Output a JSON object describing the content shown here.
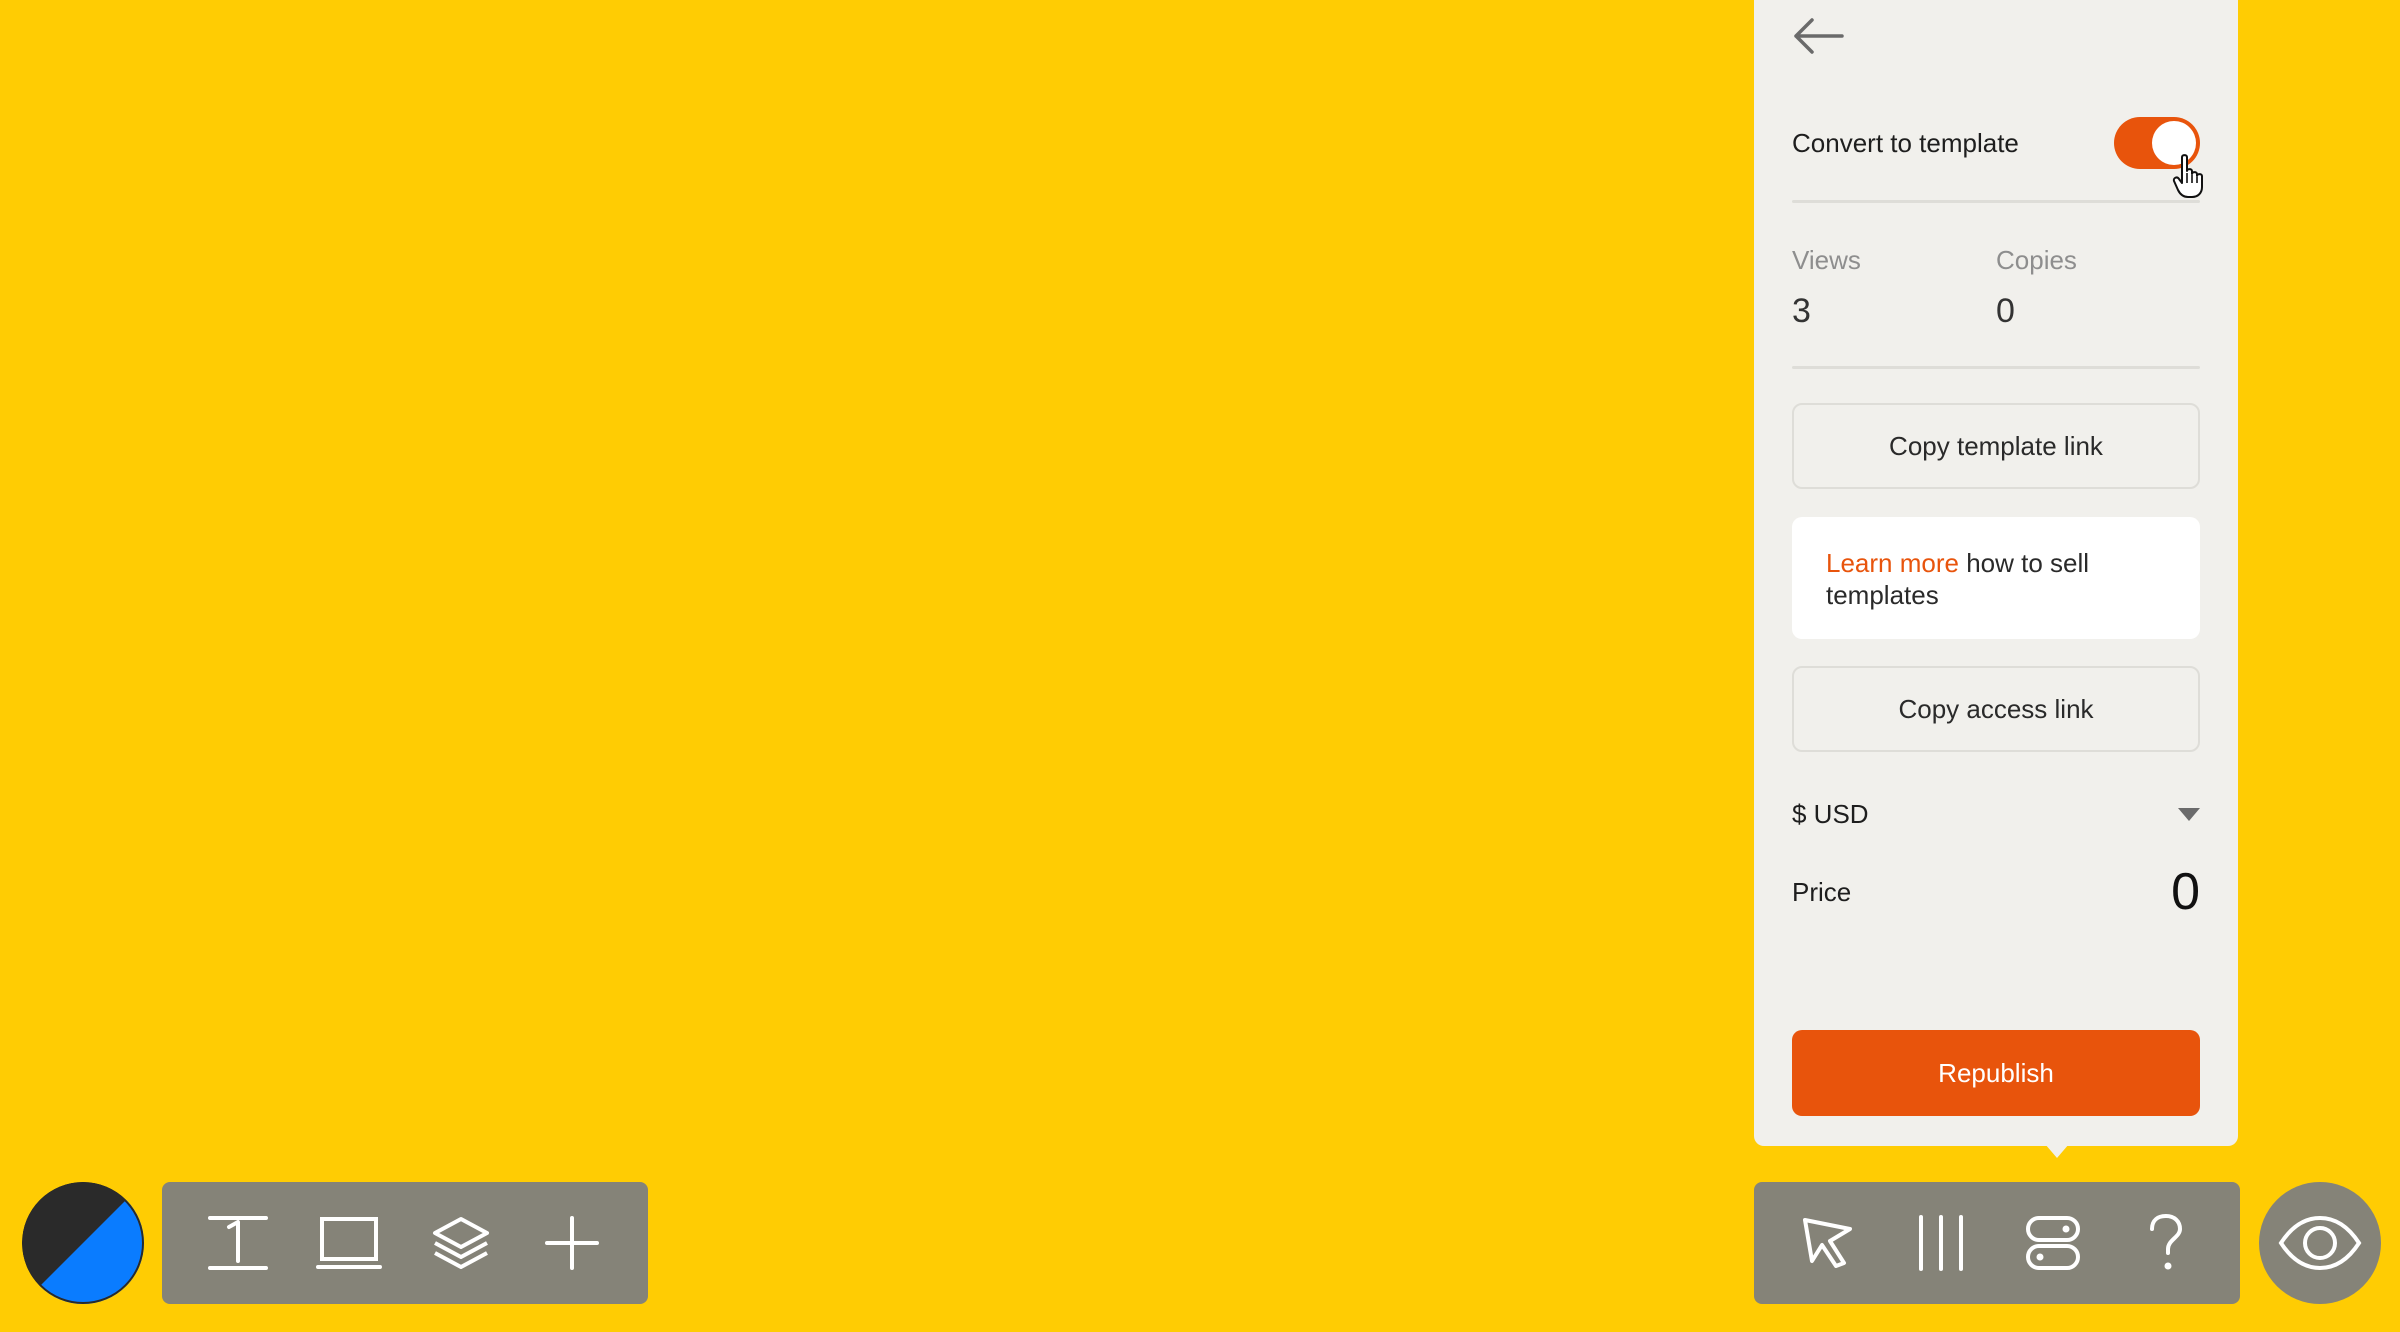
{
  "colors": {
    "background": "#FFCC03",
    "accent": "#E8540C",
    "panel": "#F1F0EC",
    "toolbar": "#858378"
  },
  "panel": {
    "back_icon": "arrow-left-icon",
    "convert_label": "Convert to template",
    "convert_enabled": true,
    "stats": [
      {
        "label": "Views",
        "value": "3"
      },
      {
        "label": "Copies",
        "value": "0"
      }
    ],
    "copy_template_label": "Copy template link",
    "info": {
      "link_text": "Learn more",
      "rest_text": " how to sell templates"
    },
    "copy_access_label": "Copy access link",
    "currency": "$ USD",
    "price_label": "Price",
    "price_value": "0",
    "republish_label": "Republish"
  },
  "toolbar_left": {
    "avatar_icon": "theme-color-icon",
    "tools": [
      "text-tool-icon",
      "frame-tool-icon",
      "layers-icon",
      "add-icon"
    ]
  },
  "toolbar_right": {
    "tools": [
      "select-cursor-icon",
      "columns-icon",
      "sections-icon",
      "help-icon"
    ],
    "preview_icon": "eye-icon"
  }
}
